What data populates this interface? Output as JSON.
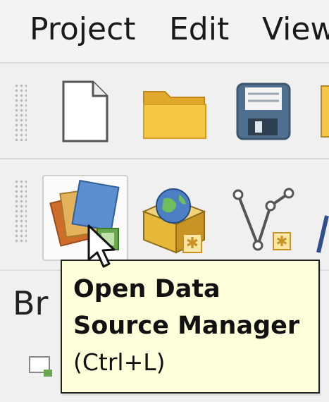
{
  "menubar": {
    "items": [
      {
        "label": "Project"
      },
      {
        "label": "Edit"
      },
      {
        "label": "View"
      }
    ]
  },
  "toolbar_file": {
    "buttons": [
      {
        "icon": "new-project-icon"
      },
      {
        "icon": "open-project-folder-icon"
      },
      {
        "icon": "save-project-icon"
      }
    ]
  },
  "toolbar_data": {
    "buttons": [
      {
        "icon": "data-source-manager-icon",
        "pressed": true
      },
      {
        "icon": "add-layer-globe-box-icon"
      },
      {
        "icon": "digitize-vertex-icon"
      }
    ]
  },
  "browser_panel": {
    "title_visible": "Br"
  },
  "tooltip": {
    "title_line1": "Open Data",
    "title_line2": "Source Manager",
    "shortcut": "(Ctrl+L)"
  },
  "colors": {
    "tooltip_bg": "#ffffdc",
    "folder_yellow": "#f5c744",
    "floppy_blue": "#4f6f8f"
  }
}
